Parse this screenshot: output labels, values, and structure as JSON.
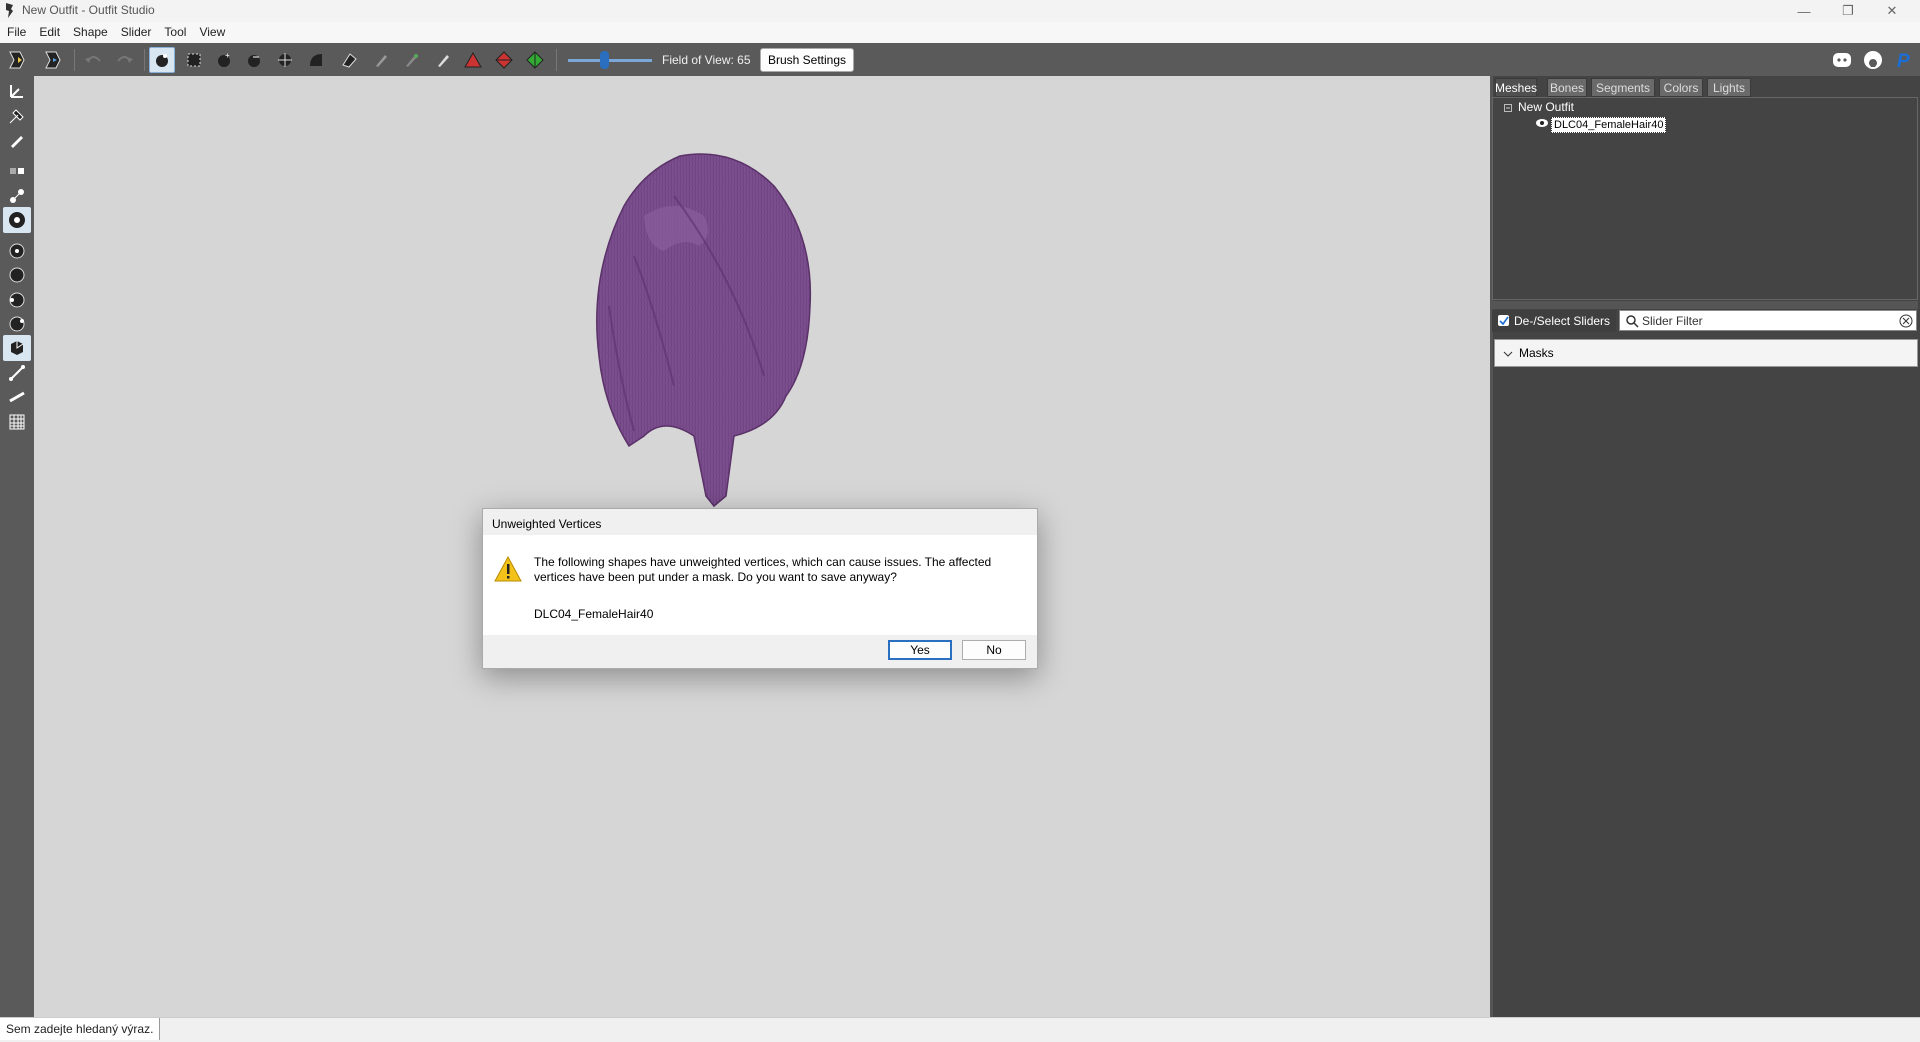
{
  "window": {
    "title": "New Outfit - Outfit Studio",
    "controls": [
      "minimize-icon",
      "restore-icon",
      "close-icon"
    ]
  },
  "menu": [
    "File",
    "Edit",
    "Shape",
    "Slider",
    "Tool",
    "View"
  ],
  "toolbar": {
    "fov_label": "Field of View: 65",
    "fov_value": 65,
    "brush_settings_label": "Brush Settings",
    "right_icons": [
      "discord-icon",
      "github-icon",
      "paypal-icon"
    ]
  },
  "right_panel": {
    "tabs": [
      "Meshes",
      "Bones",
      "Segments",
      "Colors",
      "Lights"
    ],
    "active_tab": "Meshes",
    "tree": {
      "root": "New Outfit",
      "child": "DLC04_FemaleHair40"
    },
    "deselect_sliders_label": "De-/Select Sliders",
    "slider_filter_placeholder": "Slider Filter",
    "masks_label": "Masks"
  },
  "status_bar": {
    "search_text": "Sem zadejte hledaný výraz."
  },
  "dialog": {
    "title": "Unweighted Vertices",
    "message": "The following shapes have unweighted vertices, which can cause issues. The affected vertices have been put under a mask. Do you want to save anyway?",
    "shape_name": "DLC04_FemaleHair40",
    "yes_label": "Yes",
    "no_label": "No"
  },
  "colors": {
    "mesh": "#7b4f8e",
    "viewport": "#d6d6d6",
    "panel": "#444444",
    "accent": "#2a6fc0"
  }
}
